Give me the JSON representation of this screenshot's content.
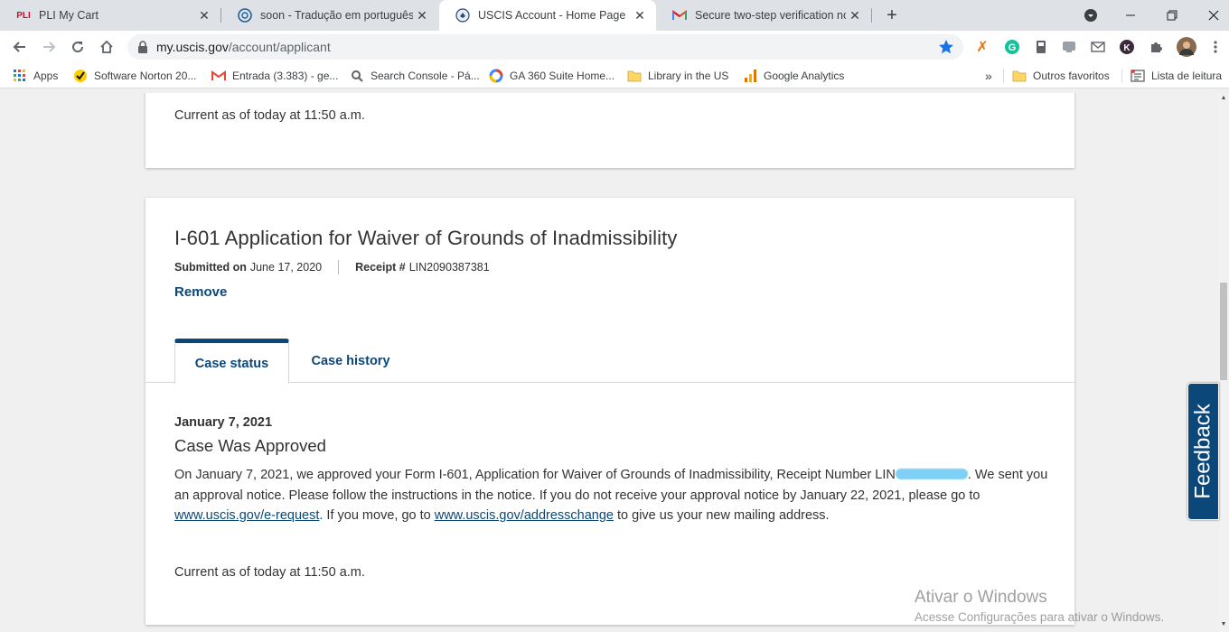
{
  "browser": {
    "tabs": [
      {
        "title": "PLI My Cart",
        "favicon": "pli-logo-icon",
        "active": false
      },
      {
        "title": "soon - Tradução em português -",
        "favicon": "reverso-icon",
        "active": false
      },
      {
        "title": "USCIS Account - Home Page",
        "favicon": "dhs-seal-icon",
        "active": true
      },
      {
        "title": "Secure two-step verification noti",
        "favicon": "gmail-icon",
        "active": false
      }
    ],
    "url_host": "my.uscis.gov",
    "url_path": "/account/applicant",
    "bookmarks": [
      {
        "label": "Apps",
        "icon": "apps-grid-icon"
      },
      {
        "label": "Software Norton 20...",
        "icon": "norton-icon"
      },
      {
        "label": "Entrada (3.383) - ge...",
        "icon": "gmail-icon"
      },
      {
        "label": "Search Console - Pá...",
        "icon": "search-console-icon"
      },
      {
        "label": "GA 360 Suite Home...",
        "icon": "google-icon"
      },
      {
        "label": "Library in the US",
        "icon": "folder-icon"
      },
      {
        "label": "Google Analytics",
        "icon": "analytics-icon"
      },
      {
        "label": "»",
        "icon": ""
      },
      {
        "label": "Outros favoritos",
        "icon": "folder-icon"
      },
      {
        "label": "Lista de leitura",
        "icon": "reading-list-icon"
      }
    ],
    "colors": {
      "tabbar": "#dee1e6",
      "star": "#1a73e8"
    }
  },
  "page": {
    "prev_card": {
      "current_as_of": "Current as of today at 11:50 a.m."
    },
    "case": {
      "title": "I-601 Application for Waiver of Grounds of Inadmissibility",
      "submitted_label": "Submitted on",
      "submitted_date": "June 17, 2020",
      "receipt_label": "Receipt #",
      "receipt_number": "LIN2090387381",
      "remove_label": "Remove",
      "tabs": [
        "Case status",
        "Case history"
      ],
      "status_date": "January 7, 2021",
      "status_title": "Case Was Approved",
      "body_part1": "On January 7, 2021, we approved your Form I-601, Application for Waiver of Grounds of Inadmissibility, Receipt Number LIN",
      "body_part2": ". We sent you an approval notice. Please follow the instructions in the notice. If you do not receive your approval notice by January 22, 2021, please go to ",
      "link1": "www.uscis.gov/e-request",
      "body_part3": ". If you move, go to ",
      "link2": "www.uscis.gov/addresschange",
      "body_part4": " to give us your new mailing address.",
      "current_as_of": "Current as of today at 11:50 a.m."
    },
    "feedback_label": "Feedback",
    "colors": {
      "primary": "#0b4778",
      "text": "#333333"
    }
  },
  "watermark": {
    "line1": "Ativar o Windows",
    "line2": "Acesse Configurações para ativar o Windows."
  }
}
